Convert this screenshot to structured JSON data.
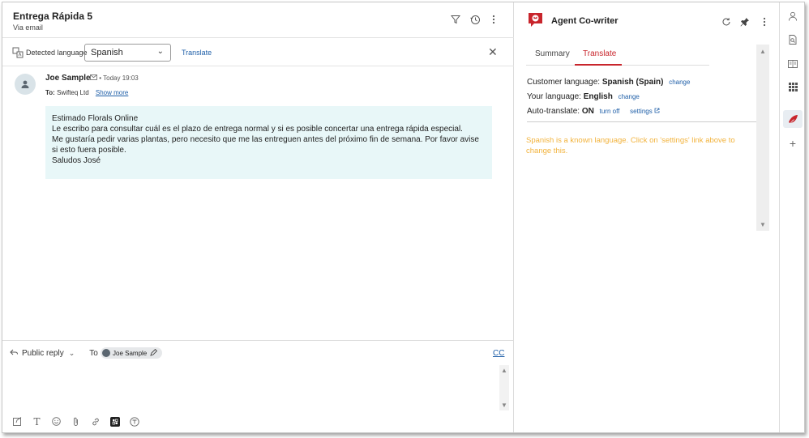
{
  "ticket": {
    "title": "Entrega Rápida 5",
    "subtitle": "Via email",
    "icons": [
      "filter-icon",
      "history-icon",
      "more-vert-icon"
    ]
  },
  "language_bar": {
    "label": "Detected language",
    "selected": "Spanish",
    "translate": "Translate"
  },
  "message": {
    "sender": "Joe Sample",
    "time": "Today 19:03",
    "to_label": "To:",
    "to_value": "Swifteq Ltd",
    "show_more": "Show more",
    "lines": [
      "Estimado Florals Online",
      "Le escribo para consultar cuál es el plazo de entrega normal y si es posible concertar una entrega rápida especial.",
      "Me gustaría pedir varias plantas, pero necesito que me las entreguen antes del próximo fin de semana. Por favor avise si esto fuera posible.",
      "Saludos José"
    ]
  },
  "reply": {
    "mode": "Public reply",
    "to_label": "To",
    "recipient": "Joe Sample",
    "cc": "CC"
  },
  "app": {
    "title": "Agent Co-writer",
    "tabs": [
      "Summary",
      "Translate"
    ],
    "active_tab": "Translate",
    "customer_language_label": "Customer language:",
    "customer_language": "Spanish (Spain)",
    "change": "change",
    "your_language_label": "Your language:",
    "your_language": "English",
    "auto_translate_label": "Auto-translate:",
    "auto_translate": "ON",
    "turn_off": "turn off",
    "settings": "settings",
    "warning": "Spanish is a known language. Click on 'settings' link above to change this."
  },
  "colors": {
    "accent_red": "#c8252c",
    "link_blue": "#1f5fa8",
    "warning": "#f2b33d",
    "message_bg": "#e8f7f8"
  }
}
